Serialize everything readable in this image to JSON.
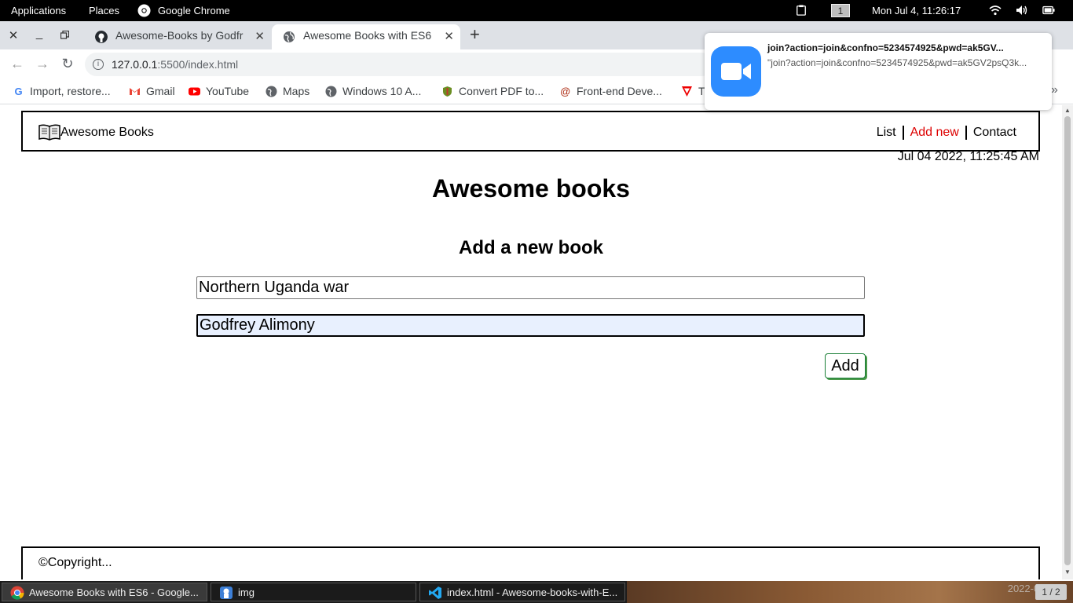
{
  "system": {
    "applications_label": "Applications",
    "places_label": "Places",
    "active_app": "Google Chrome",
    "workspace": "1",
    "clock": "Mon Jul  4, 11:26:17"
  },
  "browser": {
    "tabs": [
      {
        "title": "Awesome-Books by Godfr",
        "active": false
      },
      {
        "title": "Awesome Books with ES6",
        "active": true
      }
    ],
    "new_tab_label": "+",
    "url_host": "127.0.0.1",
    "url_path": ":5500/index.html",
    "bookmarks": [
      {
        "label": "Import, restore...",
        "icon": "google-g-icon"
      },
      {
        "label": "Gmail",
        "icon": "gmail-icon"
      },
      {
        "label": "YouTube",
        "icon": "youtube-icon"
      },
      {
        "label": "Maps",
        "icon": "globe-icon"
      },
      {
        "label": "Windows 10 A...",
        "icon": "globe-icon"
      },
      {
        "label": "Convert PDF to...",
        "icon": "shield-icon"
      },
      {
        "label": "Front-end Deve...",
        "icon": "codewars-icon"
      },
      {
        "label": "T",
        "icon": "triangle-icon"
      }
    ],
    "bookmarks_overflow": "»"
  },
  "notification": {
    "title": "join?action=join&confno=5234574925&pwd=ak5GV...",
    "body": "\"join?action=join&confno=5234574925&pwd=ak5GV2psQ3k..."
  },
  "site": {
    "brand": "Awesome Books",
    "nav": [
      {
        "label": "List",
        "active": false
      },
      {
        "label": "Add new",
        "active": true
      },
      {
        "label": "Contact",
        "active": false
      }
    ],
    "datetime": "Jul 04 2022, 11:25:45 AM",
    "main_title": "Awesome books",
    "form_title": "Add a new book",
    "title_value": "Northern Uganda war",
    "author_value": "Godfrey Alimony",
    "add_label": "Add",
    "footer": "©Copyright..."
  },
  "taskbar": {
    "tasks": [
      {
        "label": "Awesome Books with ES6 - Google...",
        "active": true
      },
      {
        "label": "img",
        "active": false
      },
      {
        "label": "index.html - Awesome-books-with-E...",
        "active": false
      }
    ],
    "wallpaper_date": "2022-07-0",
    "pager": "1 / 2"
  },
  "colors": {
    "accent_active_nav": "#dd0000",
    "zoom_blue": "#2d8cff",
    "focus_bg": "#e8f0fe",
    "add_button_border": "#1a7f37"
  }
}
